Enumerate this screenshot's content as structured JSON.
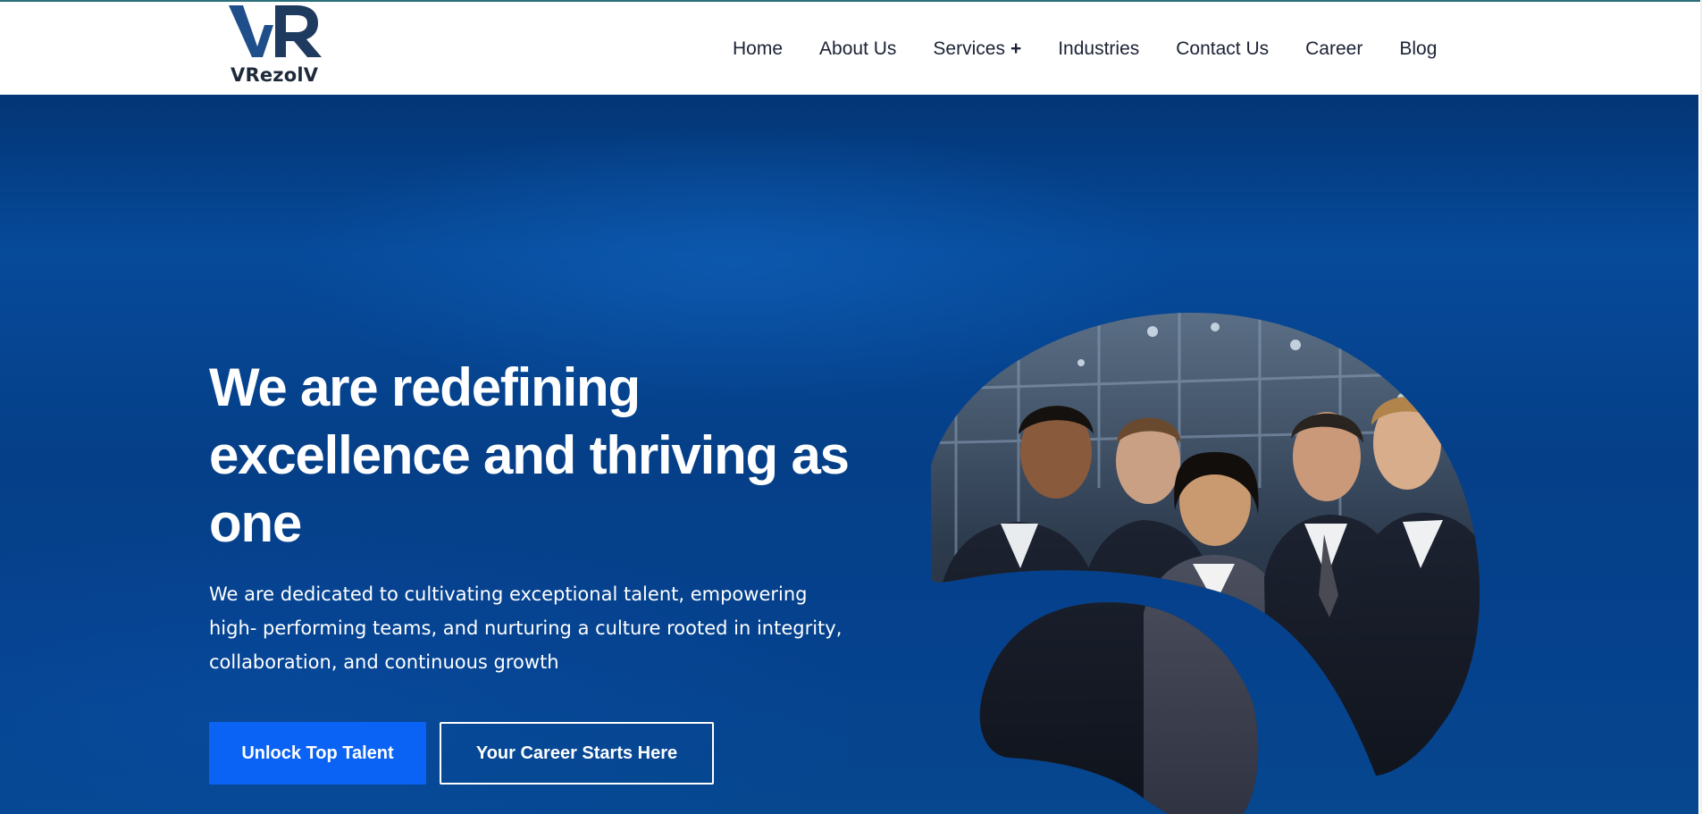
{
  "brand": {
    "monogram": "VR",
    "name": "VRezolV",
    "colors": {
      "dark": "#1e3a5f",
      "mid": "#1f4f8a"
    }
  },
  "nav": {
    "items": [
      {
        "label": "Home"
      },
      {
        "label": "About Us"
      },
      {
        "label": "Services",
        "expand": "+"
      },
      {
        "label": "Industries"
      },
      {
        "label": "Contact Us"
      },
      {
        "label": "Career"
      },
      {
        "label": "Blog"
      }
    ]
  },
  "hero": {
    "headline": "We are redefining excellence and thriving as one",
    "lead": "We are dedicated to cultivating exceptional talent, empowering high- performing teams, and nurturing a culture rooted in integrity, collaboration, and continuous growth",
    "primary_button": "Unlock Top Talent",
    "secondary_button": "Your Career Starts Here",
    "colors": {
      "background": "#053f88",
      "primary_button": "#0a63f5"
    }
  },
  "icons": {
    "services_expand": "plus-icon"
  }
}
